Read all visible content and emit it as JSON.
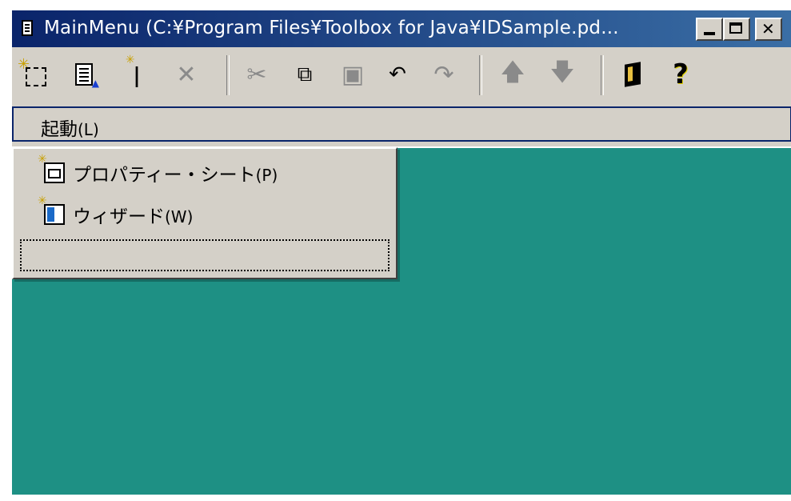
{
  "window": {
    "title": "MainMenu (C:¥Program Files¥Toolbox for Java¥IDSample.pd...",
    "title_icon": "document-icon"
  },
  "toolbar": {
    "buttons": [
      {
        "name": "new",
        "icon": "new-icon",
        "enabled": true
      },
      {
        "name": "properties",
        "icon": "document-properties-icon",
        "enabled": true
      },
      {
        "name": "wizard",
        "icon": "magic-wand-icon",
        "enabled": true
      },
      {
        "name": "delete",
        "icon": "close-x-icon",
        "enabled": false
      },
      {
        "name": "cut",
        "icon": "scissors-icon",
        "enabled": false
      },
      {
        "name": "copy",
        "icon": "copy-icon",
        "enabled": true
      },
      {
        "name": "paste",
        "icon": "paste-icon",
        "enabled": false
      },
      {
        "name": "undo",
        "icon": "undo-icon",
        "enabled": true
      },
      {
        "name": "redo",
        "icon": "redo-icon",
        "enabled": false
      },
      {
        "name": "move-up",
        "icon": "arrow-up-icon",
        "enabled": false
      },
      {
        "name": "move-down",
        "icon": "arrow-down-icon",
        "enabled": false
      },
      {
        "name": "exit",
        "icon": "door-icon",
        "enabled": true
      },
      {
        "name": "help",
        "icon": "help-icon",
        "enabled": true
      }
    ]
  },
  "menubar": {
    "launch_label": "起動",
    "launch_mnemonic": "(L)"
  },
  "dropdown": {
    "items": [
      {
        "label": "プロパティー・シート",
        "mnemonic": "(P)",
        "icon": "property-sheet-icon"
      },
      {
        "label": "ウィザード",
        "mnemonic": "(W)",
        "icon": "wizard-icon"
      }
    ]
  },
  "colors": {
    "titlebar_start": "#0a246a",
    "titlebar_end": "#3a6ea5",
    "client_background": "#1e9084",
    "face": "#d4d0c8"
  }
}
